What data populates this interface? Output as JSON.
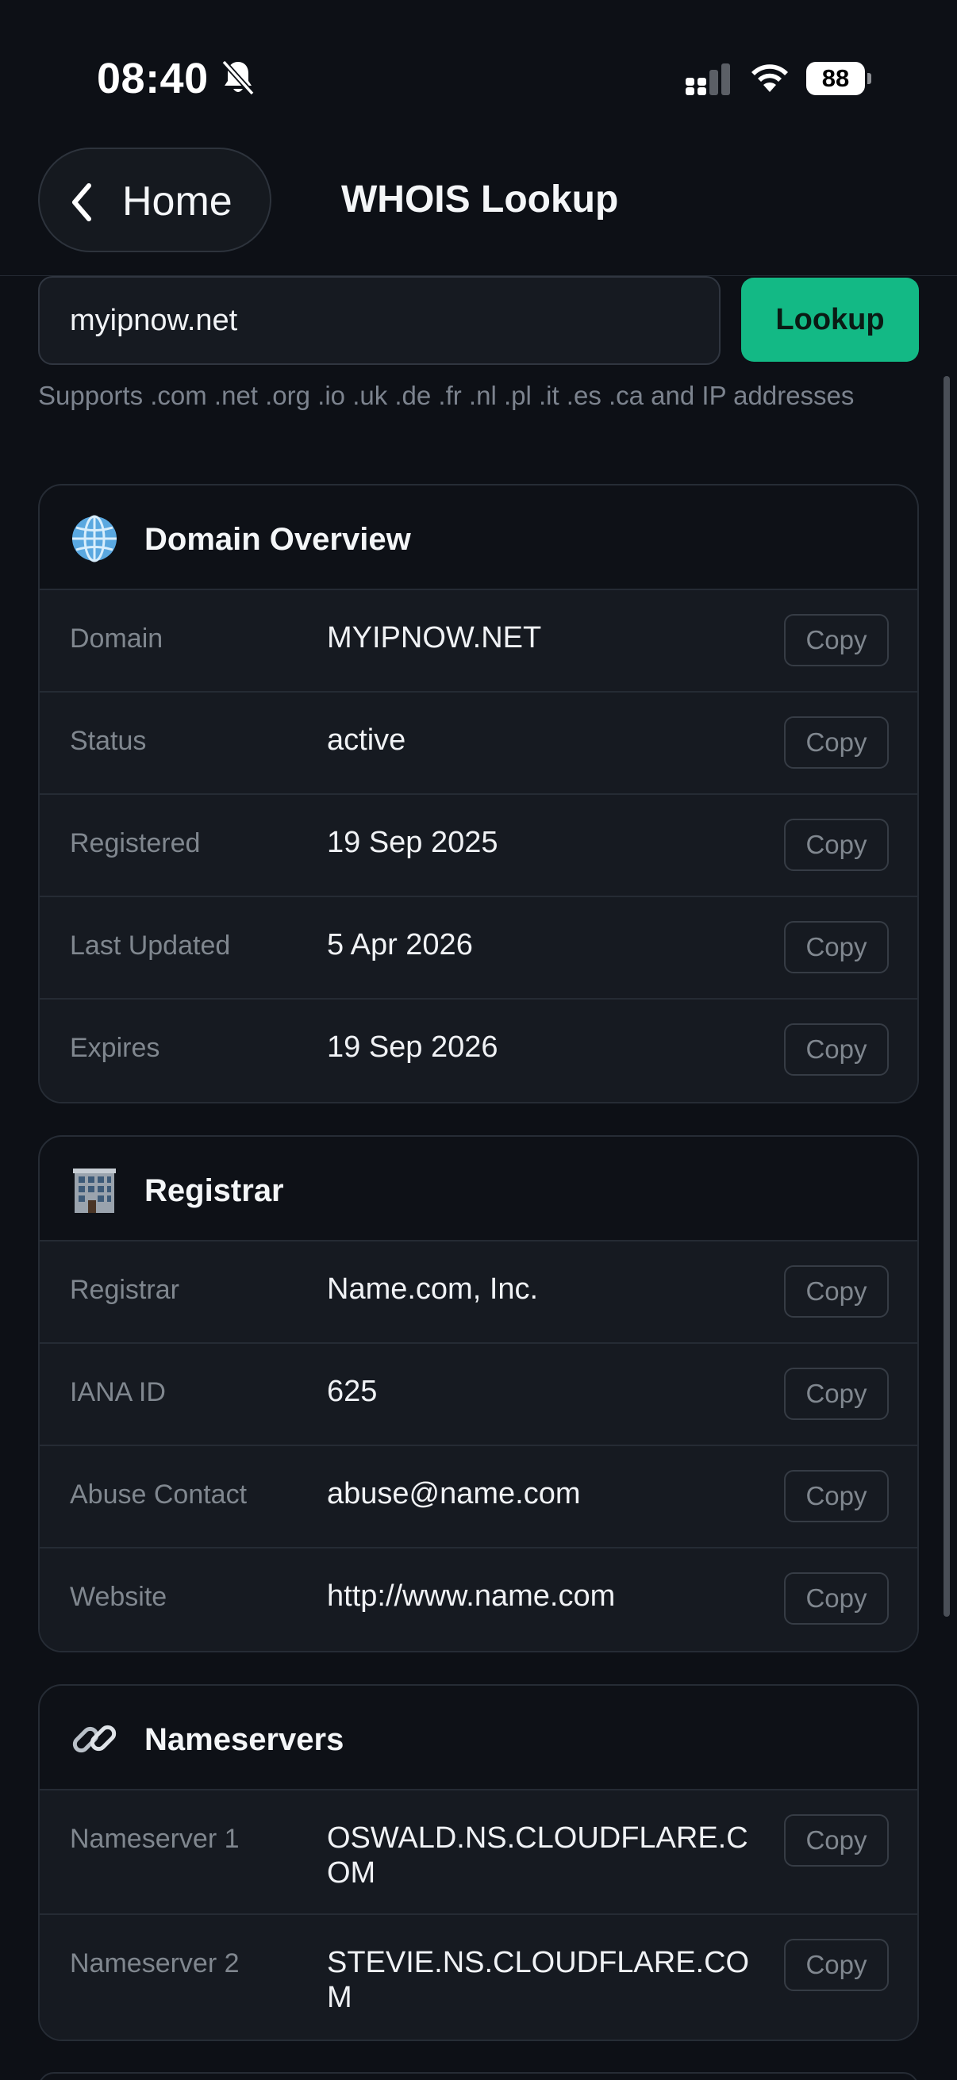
{
  "status_bar": {
    "time": "08:40",
    "battery": "88",
    "icons": [
      "bell-slash-icon",
      "signal-icon",
      "wifi-icon",
      "battery-icon"
    ]
  },
  "nav": {
    "back_label": "Home",
    "title": "WHOIS Lookup"
  },
  "search": {
    "value": "myipnow.net",
    "button_label": "Lookup",
    "hint": "Supports .com .net .org .io .uk .de .fr .nl .pl .it .es .ca and IP addresses"
  },
  "colors": {
    "background": "#0d1016",
    "accent": "#13b985",
    "row_bg": "#161a21"
  },
  "copy_label": "Copy",
  "sections": [
    {
      "title": "Domain Overview",
      "icon": "globe-icon",
      "rows": [
        {
          "label": "Domain",
          "value": "MYIPNOW.NET"
        },
        {
          "label": "Status",
          "value": "active"
        },
        {
          "label": "Registered",
          "value": "19 Sep 2025"
        },
        {
          "label": "Last Updated",
          "value": "5 Apr 2026"
        },
        {
          "label": "Expires",
          "value": "19 Sep 2026"
        }
      ]
    },
    {
      "title": "Registrar",
      "icon": "office-building-icon",
      "rows": [
        {
          "label": "Registrar",
          "value": "Name.com, Inc."
        },
        {
          "label": "IANA ID",
          "value": "625"
        },
        {
          "label": "Abuse Contact",
          "value": "abuse@name.com"
        },
        {
          "label": "Website",
          "value": "http://www.name.com"
        }
      ]
    },
    {
      "title": "Nameservers",
      "icon": "link-icon",
      "rows": [
        {
          "label": "Nameserver 1",
          "value": "OSWALD.NS.CLOUDFLARE.COM"
        },
        {
          "label": "Nameserver 2",
          "value": "STEVIE.NS.CLOUDFLARE.COM"
        }
      ]
    }
  ]
}
